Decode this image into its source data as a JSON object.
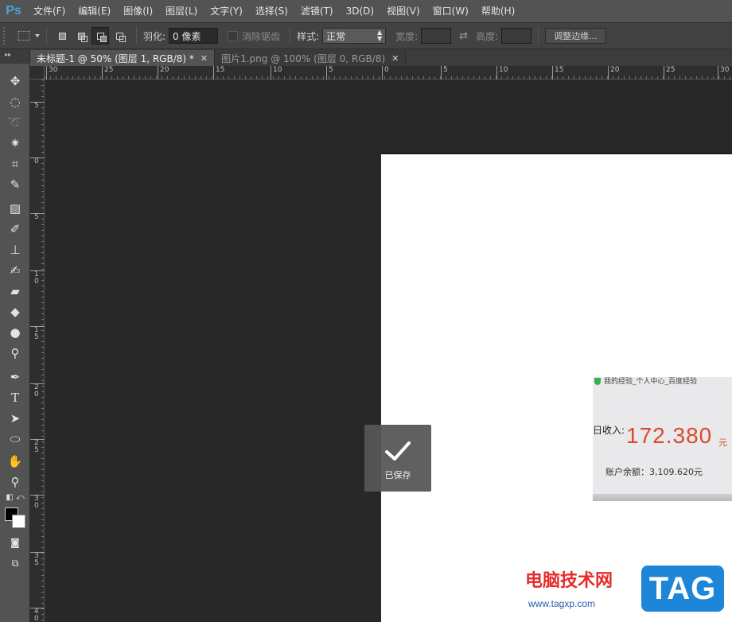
{
  "app": {
    "logo": "Ps"
  },
  "menu": [
    "文件(F)",
    "编辑(E)",
    "图像(I)",
    "图层(L)",
    "文字(Y)",
    "选择(S)",
    "滤镜(T)",
    "3D(D)",
    "视图(V)",
    "窗口(W)",
    "帮助(H)"
  ],
  "options": {
    "feather_label": "羽化:",
    "feather_value": "0 像素",
    "antialias_label": "消除锯齿",
    "style_label": "样式:",
    "style_value": "正常",
    "width_label": "宽度:",
    "height_label": "高度:",
    "refine_button": "调整边缘..."
  },
  "tabs": [
    {
      "label": "未标题-1 @ 50% (图层 1, RGB/8) *",
      "active": true
    },
    {
      "label": "图片1.png @ 100% (图层 0, RGB/8)",
      "active": false
    }
  ],
  "ruler": {
    "horizontal": [
      "30",
      "25",
      "20",
      "15",
      "10",
      "5",
      "0",
      "5",
      "10",
      "15",
      "20",
      "25",
      "30"
    ],
    "vertical": [
      "5",
      "0",
      "5",
      "1\n0",
      "1\n5",
      "2\n0",
      "2\n5",
      "3\n0",
      "3\n5",
      "4\n0"
    ]
  },
  "photo": {
    "header": "我的经验_个人中心_百度经验",
    "income_label": "日收入:",
    "amount": "172.380",
    "unit": "元",
    "balance": "账户余额：3,109.620元"
  },
  "toast": {
    "label": "已保存",
    "icon": "checkmark-icon"
  },
  "watermark": {
    "text": "电脑技术网",
    "url": "www.tagxp.com",
    "badge": "TAG"
  },
  "colors": {
    "foreground": "#000000",
    "background": "#ffffff",
    "accent": "#4aa3e0"
  }
}
